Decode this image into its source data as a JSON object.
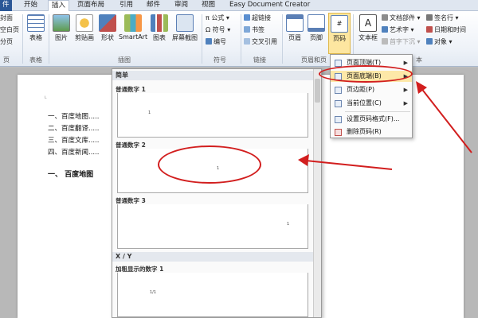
{
  "tabs": [
    {
      "label": "件",
      "kind": "file"
    },
    {
      "label": "开始"
    },
    {
      "label": "插入",
      "active": true
    },
    {
      "label": "页面布局"
    },
    {
      "label": "引用"
    },
    {
      "label": "邮件"
    },
    {
      "label": "审阅"
    },
    {
      "label": "视图"
    },
    {
      "label": "Easy Document Creator"
    }
  ],
  "ribbon": {
    "left_partial": [
      "封面",
      "空白页",
      "分页"
    ],
    "groups": {
      "pages": "页",
      "tables": "表格",
      "illustrations": "插图",
      "symbols": "符号",
      "links": "链接",
      "header_footer": "页眉和页",
      "text": "本"
    },
    "buttons": {
      "table": "表格",
      "picture": "图片",
      "clipart": "剪贴画",
      "shapes": "形状",
      "smartart": "SmartArt",
      "chart": "图表",
      "screenshot": "屏幕截图",
      "header": "页眉",
      "footer": "页脚",
      "page_number": "页码",
      "textbox": "文本框"
    },
    "symbols": {
      "formula": "公式",
      "symbol": "符号",
      "number": "编号",
      "formula_icon": "π",
      "symbol_icon": "Ω"
    },
    "links": {
      "hyperlink": "超链接",
      "bookmark": "书签",
      "crossref": "交叉引用"
    },
    "text_group": {
      "doc_parts": "文档部件",
      "wordart": "艺术字",
      "dropcap": "首字下沉",
      "signature": "签名行",
      "datetime": "日期和时间",
      "object": "对象"
    }
  },
  "menu": {
    "items": [
      {
        "label": "页面顶端(T)",
        "has_arrow": true
      },
      {
        "label": "页面底端(B)",
        "has_arrow": true,
        "highlighted": true
      },
      {
        "label": "页边距(P)",
        "has_arrow": true
      },
      {
        "label": "当前位置(C)",
        "has_arrow": true
      },
      {
        "label": "设置页码格式(F)..."
      },
      {
        "label": "删除页码(R)"
      }
    ]
  },
  "gallery": {
    "section1": "简单",
    "items": [
      {
        "label": "普通数字 1",
        "number": "1"
      },
      {
        "label": "普通数字 2",
        "number": "1"
      },
      {
        "label": "普通数字 3",
        "number": "1"
      }
    ],
    "section2": "X / Y",
    "item4": {
      "label": "加粗显示的数字 1",
      "number": "1/1"
    }
  },
  "document": {
    "list": [
      "一、百度地图.....",
      "二、百度翻译.....",
      "三、百度文库.....",
      "四、百度新闻....."
    ],
    "heading": "一、  百度地图"
  },
  "colors": {
    "annotation_red": "#d21e1e",
    "file_tab": "#2b5797",
    "menu_highlight": "#fde8a8"
  }
}
